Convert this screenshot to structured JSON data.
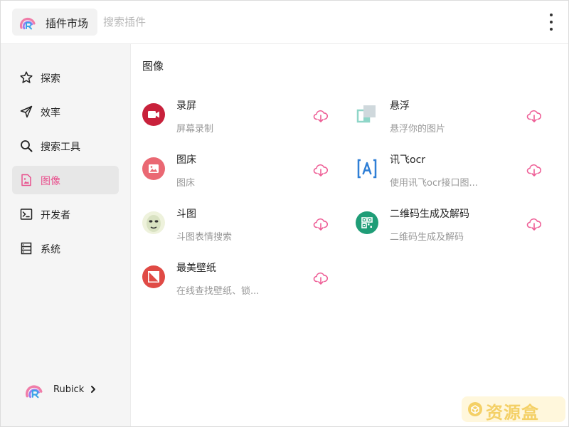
{
  "header": {
    "app_title": "插件市场",
    "search_placeholder": "搜索插件"
  },
  "sidebar": {
    "items": [
      {
        "label": "探索",
        "icon": "star-icon"
      },
      {
        "label": "效率",
        "icon": "send-icon"
      },
      {
        "label": "搜索工具",
        "icon": "search-icon"
      },
      {
        "label": "图像",
        "icon": "image-file-icon",
        "active": true
      },
      {
        "label": "开发者",
        "icon": "terminal-icon"
      },
      {
        "label": "系统",
        "icon": "server-icon"
      }
    ],
    "user": {
      "name": "Rubick"
    }
  },
  "main": {
    "section_title": "图像",
    "plugins": [
      {
        "name": "录屏",
        "desc": "屏幕录制",
        "icon": "video-camera-icon"
      },
      {
        "name": "悬浮",
        "desc": "悬浮你的图片",
        "icon": "float-window-icon"
      },
      {
        "name": "图床",
        "desc": "图床",
        "icon": "picture-icon"
      },
      {
        "name": "讯飞ocr",
        "desc": "使用讯飞ocr接口图...",
        "icon": "ocr-text-icon"
      },
      {
        "name": "斗图",
        "desc": "斗图表情搜索",
        "icon": "meme-face-icon"
      },
      {
        "name": "二维码生成及解码",
        "desc": "二维码生成及解码",
        "icon": "qr-code-icon"
      },
      {
        "name": "最美壁纸",
        "desc": "在线查找壁纸、锁...",
        "icon": "wallpaper-icon"
      }
    ]
  },
  "watermark": {
    "text": "资源盒"
  },
  "colors": {
    "accent": "#e8508d",
    "sidebar_bg": "#f5f5f5",
    "active_bg": "#e7e7e7"
  }
}
